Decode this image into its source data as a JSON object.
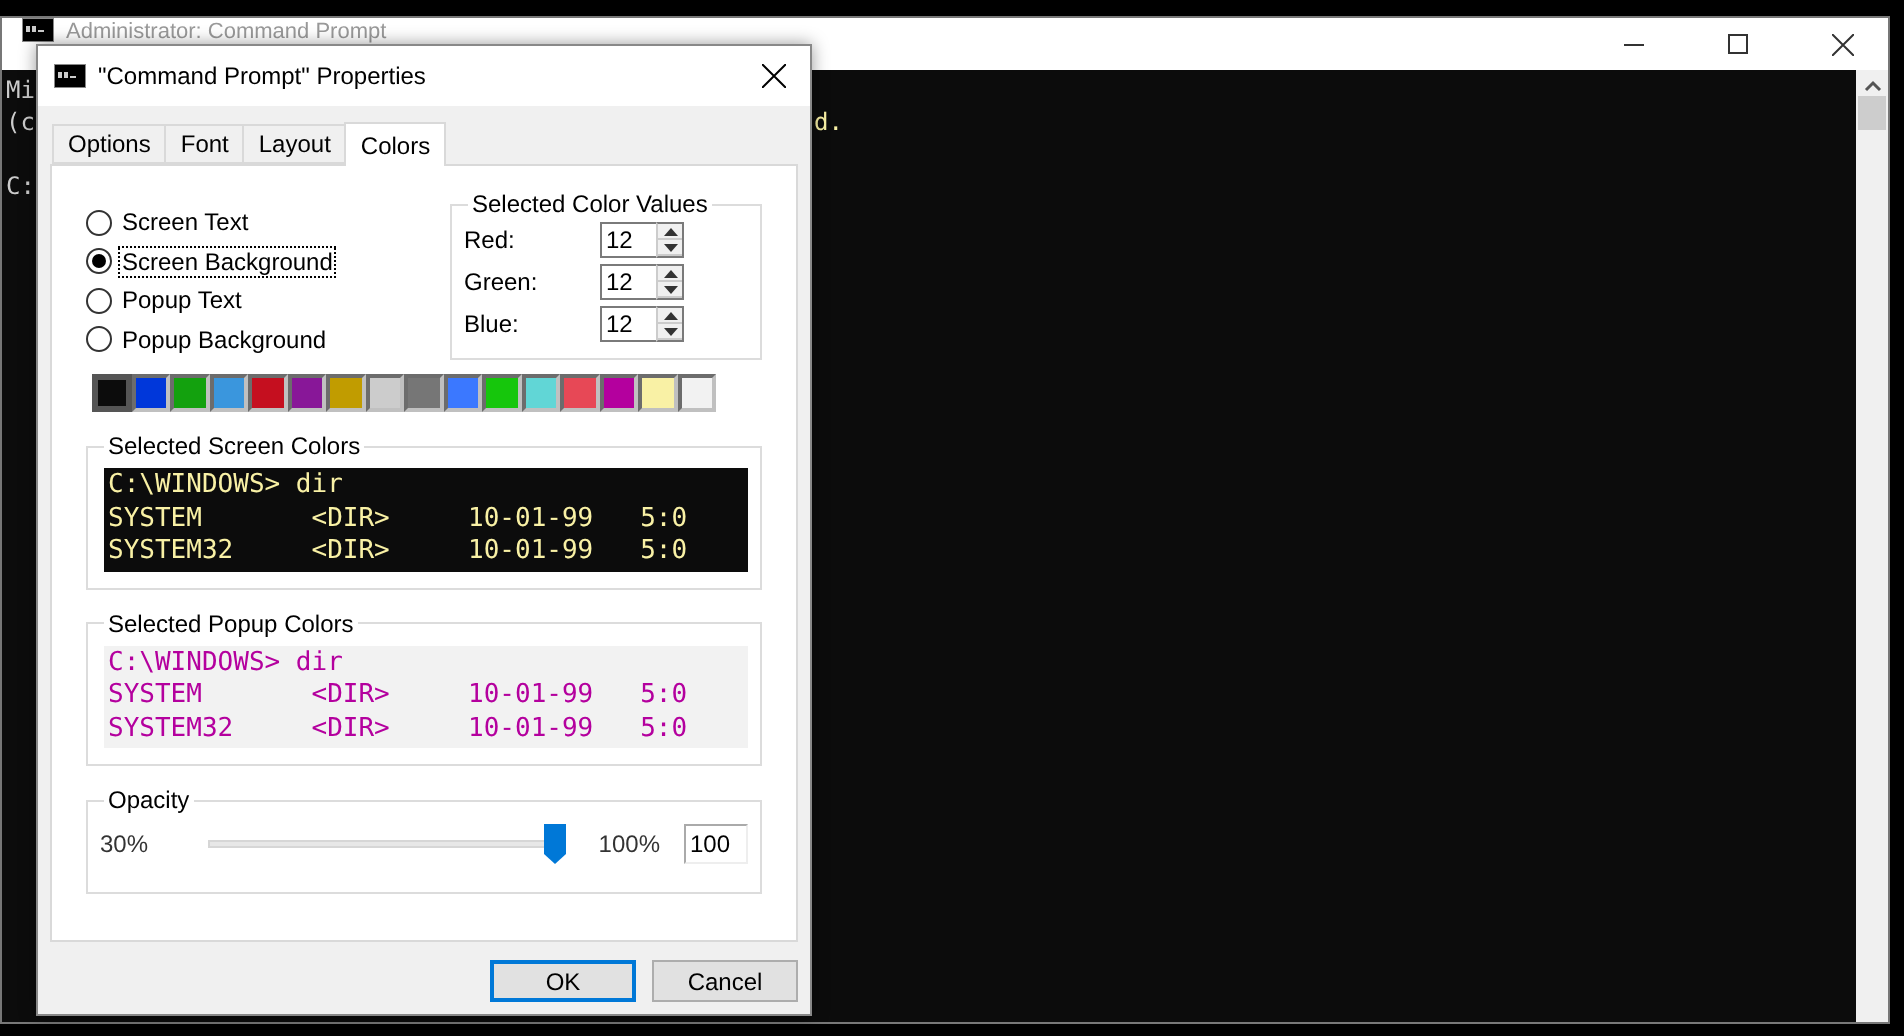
{
  "console": {
    "title": "Administrator: Command Prompt",
    "lines": [
      "Mi",
      "(c"
    ],
    "prompt": "C:",
    "right_fragment": "d."
  },
  "dialog": {
    "title": "\"Command Prompt\" Properties",
    "tabs": [
      {
        "label": "Options",
        "selected": false
      },
      {
        "label": "Font",
        "selected": false
      },
      {
        "label": "Layout",
        "selected": false
      },
      {
        "label": "Colors",
        "selected": true
      }
    ],
    "targets": [
      {
        "label": "Screen Text",
        "selected": false
      },
      {
        "label": "Screen Background",
        "selected": true
      },
      {
        "label": "Popup Text",
        "selected": false
      },
      {
        "label": "Popup Background",
        "selected": false
      }
    ],
    "color_values": {
      "title": "Selected Color Values",
      "fields": [
        {
          "label": "Red:",
          "value": "12"
        },
        {
          "label": "Green:",
          "value": "12"
        },
        {
          "label": "Blue:",
          "value": "12"
        }
      ]
    },
    "swatches": [
      {
        "color": "#0c0c0c",
        "selected": true
      },
      {
        "color": "#0037da",
        "selected": false
      },
      {
        "color": "#13a10e",
        "selected": false
      },
      {
        "color": "#3a96dd",
        "selected": false
      },
      {
        "color": "#c50f1f",
        "selected": false
      },
      {
        "color": "#881798",
        "selected": false
      },
      {
        "color": "#c19c00",
        "selected": false
      },
      {
        "color": "#cccccc",
        "selected": false
      },
      {
        "color": "#767676",
        "selected": false
      },
      {
        "color": "#3b78ff",
        "selected": false
      },
      {
        "color": "#16c60c",
        "selected": false
      },
      {
        "color": "#61d6d6",
        "selected": false
      },
      {
        "color": "#e74856",
        "selected": false
      },
      {
        "color": "#b4009e",
        "selected": false
      },
      {
        "color": "#f9f1a5",
        "selected": false
      },
      {
        "color": "#f2f2f2",
        "selected": false
      }
    ],
    "screen_preview": {
      "title": "Selected Screen Colors",
      "kind": "screen",
      "lines": [
        "C:\\WINDOWS> dir",
        "SYSTEM       <DIR>     10-01-99   5:0",
        "SYSTEM32     <DIR>     10-01-99   5:0"
      ]
    },
    "popup_preview": {
      "title": "Selected Popup Colors",
      "kind": "popup",
      "lines": [
        "C:\\WINDOWS> dir",
        "SYSTEM       <DIR>     10-01-99   5:0",
        "SYSTEM32     <DIR>     10-01-99   5:0"
      ]
    },
    "opacity": {
      "title": "Opacity",
      "min_label": "30%",
      "max_label": "100%",
      "level": 1,
      "value": "100"
    },
    "buttons": [
      {
        "label": "OK",
        "default": true
      },
      {
        "label": "Cancel",
        "default": false
      }
    ]
  }
}
